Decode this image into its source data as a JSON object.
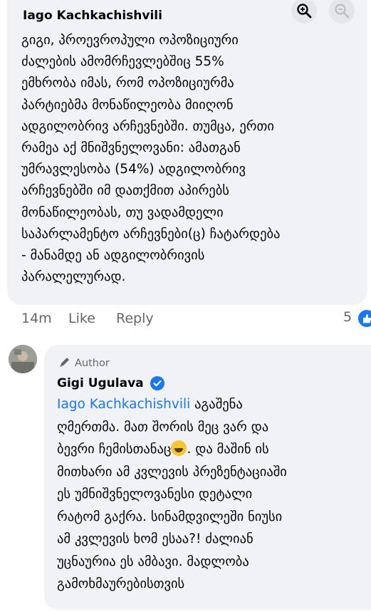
{
  "comment1": {
    "author": "Iago Kachkachishvili",
    "lines": [
      "გიგი, პროევროპული ოპოზიციური",
      "ძალების ამომრჩევლებშიც 55%",
      "ემხრობა იმას, რომ ოპოზიციურმა",
      "პარტიებმა მონაწილეობა მიიღონ",
      "ადგილობრივ არჩევნებში. თუმცა, ერთი",
      "რამეა აქ მნიშვნელოვანი: ამათგან",
      "უმრავლესობა (54%) ადგილობრივ",
      "არჩევნებში იმ დათქმით აპირებს",
      "მონაწილეობას, თუ ვადამდელი",
      "საპარლამენტო არჩევნები(ც) ჩატარდება",
      "- მანამდე ან ადგილობრივის",
      "პარალელურად."
    ],
    "time": "14m",
    "like_label": "Like",
    "reply_label": "Reply",
    "reaction_count": "5"
  },
  "comment2": {
    "badge": "Author",
    "author": "Gigi Ugulava",
    "mention": "Iago Kachkachishvili",
    "line1_rest": " აგაშენა",
    "line2": "ღმერთმა. მათ შორის მეც ვარ და",
    "line3": "ბევრი ჩემისთანაც",
    "line3_after": ". და მაშინ ის",
    "lines_rest": [
      "მითხარი ამ კვლევის პრეზენტაციაში",
      "ეს უმნიშვნელოვანესი დეტალი",
      "რატომ გაქრა. სინამდვილეში ნიუსი",
      "ამ კვლევის ხომ ესაა?! ძალიან",
      "უცნაურია ეს ამბავი. მადლობა",
      "გამოხმაურებისთვის"
    ]
  },
  "icons": {
    "zoom_in": "zoom-in-icon",
    "zoom_out": "zoom-out-icon",
    "author_badge": "pen-icon",
    "verified": "verified-check-icon",
    "reaction": "like-reaction-icon",
    "emoji": "sweat-smile-emoji"
  },
  "colors": {
    "bubble": "#f0f2f5",
    "link": "#1877f2",
    "meta": "#65676b"
  }
}
